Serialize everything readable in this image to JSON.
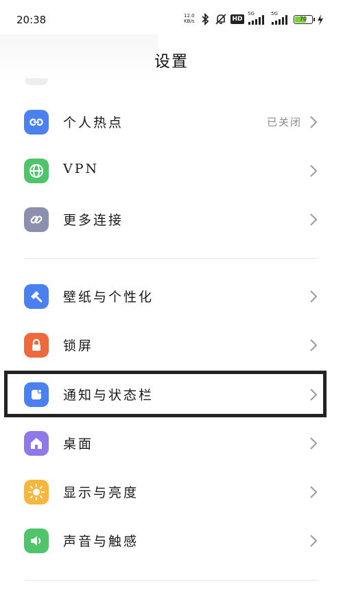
{
  "status_bar": {
    "time": "20:38",
    "net_speed_value": "12.0",
    "net_speed_unit": "KB/s",
    "hd_label": "HD",
    "signal1_label": "5G",
    "signal2_label": "5G",
    "battery_level": "70",
    "icons": [
      "bluetooth-icon",
      "silent-bell-icon",
      "hd-icon",
      "signal-icon",
      "battery-icon",
      "charging-icon"
    ]
  },
  "header": {
    "title": "设置"
  },
  "rows": [
    {
      "label": "个人热点",
      "value": "已关闭",
      "icon": "hotspot-icon",
      "color": "#4a80f0"
    },
    {
      "label": "VPN",
      "value": "",
      "icon": "globe-icon",
      "color": "#4fc46a"
    },
    {
      "label": "更多连接",
      "value": "",
      "icon": "link-icon",
      "color": "#8d8fae"
    },
    {
      "label": "壁纸与个性化",
      "value": "",
      "icon": "brush-icon",
      "color": "#4a80f0"
    },
    {
      "label": "锁屏",
      "value": "",
      "icon": "lock-icon",
      "color": "#ee6a3c"
    },
    {
      "label": "通知与状态栏",
      "value": "",
      "icon": "notification-icon",
      "color": "#4a80f0"
    },
    {
      "label": "桌面",
      "value": "",
      "icon": "home-icon",
      "color": "#8f78e8"
    },
    {
      "label": "显示与亮度",
      "value": "",
      "icon": "sun-icon",
      "color": "#f6b73c"
    },
    {
      "label": "声音与触感",
      "value": "",
      "icon": "speaker-icon",
      "color": "#4fc46a"
    }
  ],
  "highlighted_item": "通知与状态栏"
}
